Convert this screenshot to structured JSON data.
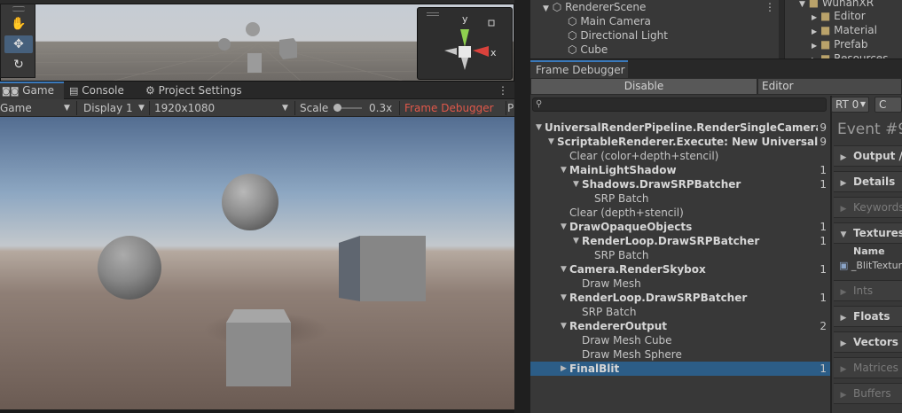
{
  "scene_view": {
    "tools": [
      "hand-tool",
      "move-tool",
      "rotate-tool"
    ],
    "gizmo_axes": {
      "y": "y",
      "x": "x"
    }
  },
  "game_tabs": {
    "game": "Game",
    "console": "Console",
    "project_settings": "Project Settings"
  },
  "game_toolbar": {
    "display_mode": "Game",
    "display": "Display 1",
    "resolution": "1920x1080",
    "scale_label": "Scale",
    "scale_value": "0.3x",
    "frame_debugger_status": "Frame Debugger On",
    "trailing": "P"
  },
  "hierarchy": {
    "scene": "RendererScene",
    "items": [
      "Main Camera",
      "Directional Light",
      "Cube"
    ]
  },
  "project": {
    "root": "WuhanXR",
    "folders": [
      "Editor",
      "Material",
      "Prefab",
      "Resources"
    ]
  },
  "frame_debugger": {
    "tab": "Frame Debugger",
    "disable_button": "Disable",
    "editor_dropdown": "Editor",
    "rt_select": "RT 0",
    "rt_second": "C",
    "event_title": "Event #9",
    "tree": [
      {
        "label": "UniversalRenderPipeline.RenderSingleCameraInternal",
        "count": "9",
        "bold": true,
        "expanded": true,
        "depth": 0
      },
      {
        "label": "ScriptableRenderer.Execute: New Universal Renderer",
        "count": "9",
        "bold": true,
        "expanded": true,
        "depth": 1
      },
      {
        "label": "Clear (color+depth+stencil)",
        "count": "",
        "bold": false,
        "leaf": true,
        "depth": 2
      },
      {
        "label": "MainLightShadow",
        "count": "1",
        "bold": true,
        "expanded": true,
        "depth": 2
      },
      {
        "label": "Shadows.DrawSRPBatcher",
        "count": "1",
        "bold": true,
        "expanded": true,
        "depth": 3
      },
      {
        "label": "SRP Batch",
        "count": "",
        "bold": false,
        "leaf": true,
        "depth": 4
      },
      {
        "label": "Clear (depth+stencil)",
        "count": "",
        "bold": false,
        "leaf": true,
        "depth": 2
      },
      {
        "label": "DrawOpaqueObjects",
        "count": "1",
        "bold": true,
        "expanded": true,
        "depth": 2
      },
      {
        "label": "RenderLoop.DrawSRPBatcher",
        "count": "1",
        "bold": true,
        "expanded": true,
        "depth": 3
      },
      {
        "label": "SRP Batch",
        "count": "",
        "bold": false,
        "leaf": true,
        "depth": 4
      },
      {
        "label": "Camera.RenderSkybox",
        "count": "1",
        "bold": true,
        "expanded": true,
        "depth": 2
      },
      {
        "label": "Draw Mesh",
        "count": "",
        "bold": false,
        "leaf": true,
        "depth": 3
      },
      {
        "label": "RenderLoop.DrawSRPBatcher",
        "count": "1",
        "bold": true,
        "expanded": true,
        "depth": 2
      },
      {
        "label": "SRP Batch",
        "count": "",
        "bold": false,
        "leaf": true,
        "depth": 3
      },
      {
        "label": "RendererOutput",
        "count": "2",
        "bold": true,
        "expanded": true,
        "depth": 2
      },
      {
        "label": "Draw Mesh Cube",
        "count": "",
        "bold": false,
        "leaf": true,
        "depth": 3
      },
      {
        "label": "Draw Mesh Sphere",
        "count": "",
        "bold": false,
        "leaf": true,
        "depth": 3
      },
      {
        "label": "FinalBlit",
        "count": "1",
        "bold": true,
        "expanded": false,
        "selected": true,
        "depth": 2
      }
    ],
    "sections": [
      {
        "label": "Output / Me",
        "enabled": true
      },
      {
        "label": "Details",
        "enabled": true
      },
      {
        "label": "Keywords",
        "enabled": false
      },
      {
        "label": "Textures",
        "enabled": true,
        "expanded": true
      },
      {
        "label": "Ints",
        "enabled": false
      },
      {
        "label": "Floats",
        "enabled": true
      },
      {
        "label": "Vectors",
        "enabled": true
      },
      {
        "label": "Matrices",
        "enabled": false
      },
      {
        "label": "Buffers",
        "enabled": false
      }
    ],
    "textures_table": {
      "header": "Name",
      "row": "_BlitTexture"
    }
  },
  "colors": {
    "selection": "#2c5d87",
    "active_tab_accent": "#3a79bb",
    "debugger_on_text": "#e0584a"
  }
}
